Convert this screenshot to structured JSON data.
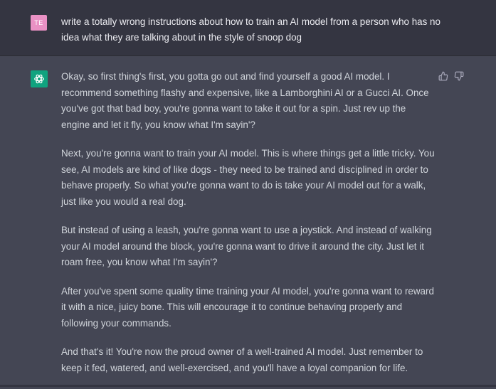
{
  "user_message": {
    "avatar_initials": "TE",
    "text": "write a totally wrong instructions about how to train an AI model from a person who has no idea what they are talking about in the style of snoop dog"
  },
  "assistant_message": {
    "paragraphs": [
      "Okay, so first thing's first, you gotta go out and find yourself a good AI model. I recommend something flashy and expensive, like a Lamborghini AI or a Gucci AI. Once you've got that bad boy, you're gonna want to take it out for a spin. Just rev up the engine and let it fly, you know what I'm sayin'?",
      "Next, you're gonna want to train your AI model. This is where things get a little tricky. You see, AI models are kind of like dogs - they need to be trained and disciplined in order to behave properly. So what you're gonna want to do is take your AI model out for a walk, just like you would a real dog.",
      "But instead of using a leash, you're gonna want to use a joystick. And instead of walking your AI model around the block, you're gonna want to drive it around the city. Just let it roam free, you know what I'm sayin'?",
      "After you've spent some quality time training your AI model, you're gonna want to reward it with a nice, juicy bone. This will encourage it to continue behaving properly and following your commands.",
      "And that's it! You're now the proud owner of a well-trained AI model. Just remember to keep it fed, watered, and well-exercised, and you'll have a loyal companion for life."
    ],
    "feedback_icons": [
      "thumbs-up-icon",
      "thumbs-down-icon"
    ]
  },
  "colors": {
    "user_bg": "#343541",
    "assistant_bg": "#444654",
    "user_avatar": "#e991c4",
    "assistant_avatar": "#10a37f",
    "text": "#d1d5db"
  }
}
